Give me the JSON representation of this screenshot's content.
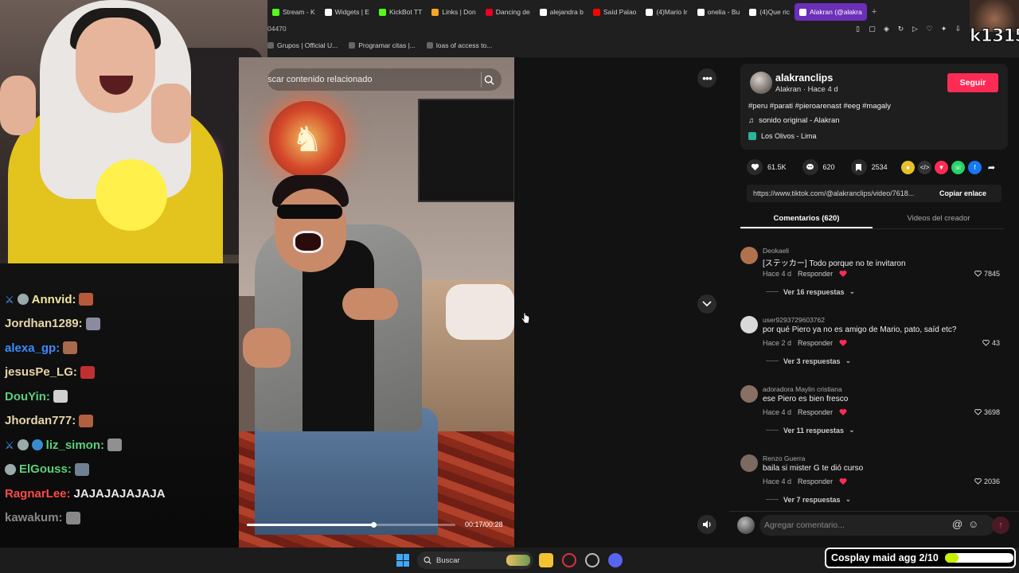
{
  "browser": {
    "tabs": [
      {
        "label": "Stream - K",
        "color": "#53fc18"
      },
      {
        "label": "Widgets | E",
        "color": "#ffffff"
      },
      {
        "label": "KickBot TT",
        "color": "#53fc18"
      },
      {
        "label": "Links | Don",
        "color": "#f5a623"
      },
      {
        "label": "Dancing de",
        "color": "#e60023"
      },
      {
        "label": "alejandra b",
        "color": "#ffffff"
      },
      {
        "label": "Saíd Palao",
        "color": "#ff0000"
      },
      {
        "label": "(4)Mario Ir",
        "color": "#ffffff"
      },
      {
        "label": "onelia - Bu",
        "color": "#ffffff"
      },
      {
        "label": "(4)Que ric",
        "color": "#ffffff"
      },
      {
        "label": "Alakran (@alakra",
        "color": "#ffffff",
        "active": true
      }
    ],
    "new_tab": "+",
    "url_fragment": "04470",
    "bookmarks": [
      "Grupos | Official U...",
      "Programar citas |...",
      "loas of access to..."
    ]
  },
  "chat": {
    "lines": [
      {
        "user": "Annvid:",
        "color": "#f0e6a0",
        "badges": [
          "sword",
          "mod"
        ]
      },
      {
        "user": "Jordhan1289:",
        "color": "#e8d6a8",
        "badges": []
      },
      {
        "user": "alexa_gp:",
        "color": "#3b8cff",
        "badges": []
      },
      {
        "user": "jesusPe_LG:",
        "color": "#e8d6a8",
        "badges": []
      },
      {
        "user": "DouYin:",
        "color": "#5ad07a",
        "badges": []
      },
      {
        "user": "Jhordan777:",
        "color": "#e8d6a8",
        "badges": []
      },
      {
        "user": "liz_simon:",
        "color": "#5ad07a",
        "badges": [
          "sword",
          "mod",
          "cube"
        ]
      },
      {
        "user": "ElGouss:",
        "color": "#5ad07a",
        "badges": [
          "mod"
        ]
      },
      {
        "user": "RagnarLee:",
        "color": "#ff4a4a",
        "badges": [],
        "message": "JAJAJAJAJAJA"
      },
      {
        "user": "kawakum:",
        "color": "#888888",
        "badges": []
      }
    ]
  },
  "video": {
    "search_placeholder": "scar contenido relacionado",
    "progress": 0.607,
    "time": "00:17/00:28"
  },
  "post": {
    "author": "alakranclips",
    "subtitle": "Alakran · Hace 4 d",
    "follow_label": "Seguir",
    "caption": "#peru #parati #pieroarenast #eeg #magaly",
    "sound": "sonido original - Alakran",
    "location": "Los Olivos - Lima",
    "likes": "61.5K",
    "comments": "620",
    "saves": "2534",
    "link": "https://www.tiktok.com/@alakranclips/video/7618...",
    "copy_label": "Copiar enlace",
    "tab_comments": "Comentarios (620)",
    "tab_videos": "Videos del creador",
    "accent": "#fe2c55"
  },
  "comments": [
    {
      "user": "Deokaeli",
      "text": "[ステッカー] Todo porque no te invitaron",
      "time": "Hace 4 d",
      "reply": "Responder",
      "likes": "7845",
      "replies": "Ver 16 respuestas",
      "avatar": "#b0714f"
    },
    {
      "user": "user9293729603762",
      "text": "por qué Piero ya no es amigo de Mario, pato, saíd etc?",
      "time": "Hace 2 d",
      "reply": "Responder",
      "likes": "43",
      "replies": "Ver 3 respuestas",
      "avatar": "#d9d9d9"
    },
    {
      "user": "adoradora Maylin cristiana",
      "text": "ese Piero es bien fresco",
      "time": "Hace 4 d",
      "reply": "Responder",
      "likes": "3698",
      "replies": "Ver 11 respuestas",
      "avatar": "#8a6f63"
    },
    {
      "user": "Renzo Guerra",
      "text": "baila si mister G te dió curso",
      "time": "Hace 4 d",
      "reply": "Responder",
      "likes": "2036",
      "replies": "Ver 7 respuestas",
      "avatar": "#7a6a60"
    }
  ],
  "comment_input_placeholder": "Agregar comentario...",
  "taskbar": {
    "search_label": "Buscar"
  },
  "overlay": {
    "cosplay_label": "Cosplay maid agg 2/10",
    "cosplay_progress": 0.2,
    "streamer_tag": "k1315"
  }
}
